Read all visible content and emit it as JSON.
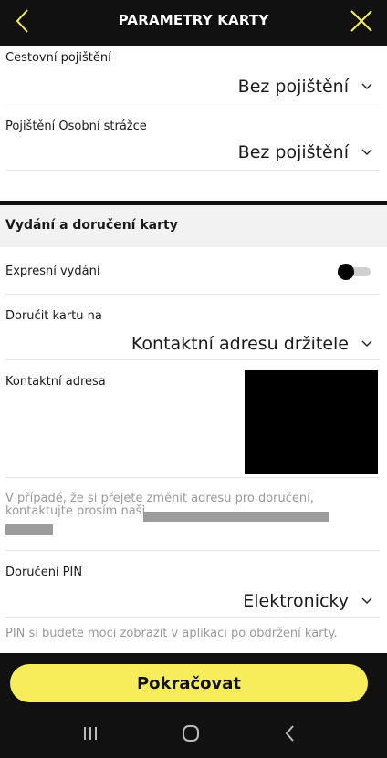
{
  "header": {
    "title": "PARAMETRY KARTY",
    "back_icon": "chevron-left-icon",
    "close_icon": "close-icon",
    "accent_color": "#f7ec5a"
  },
  "insurance": {
    "travel_label": "Cestovní pojištění",
    "travel_value": "Bez pojištění",
    "guard_label": "Pojištění Osobní strážce",
    "guard_value": "Bez pojištění"
  },
  "issue_section": {
    "title": "Vydání a doručení karty",
    "express_label": "Expresní vydání",
    "express_on": false,
    "deliver_label": "Doručit kartu na",
    "deliver_value": "Kontaktní adresu držitele",
    "address_label": "Kontaktní adresa",
    "change_note": "V případě, že si přejete změnit adresu pro doručení, kontaktujte prosím naši",
    "pin_label": "Doručení PIN",
    "pin_value": "Elektronicky",
    "pin_note": "PIN si budete moci zobrazit v aplikaci po obdržení karty."
  },
  "cta": {
    "label": "Pokračovat"
  },
  "system_nav": {
    "recent_icon": "recent-apps-icon",
    "home_icon": "home-icon",
    "back_icon": "back-icon"
  }
}
